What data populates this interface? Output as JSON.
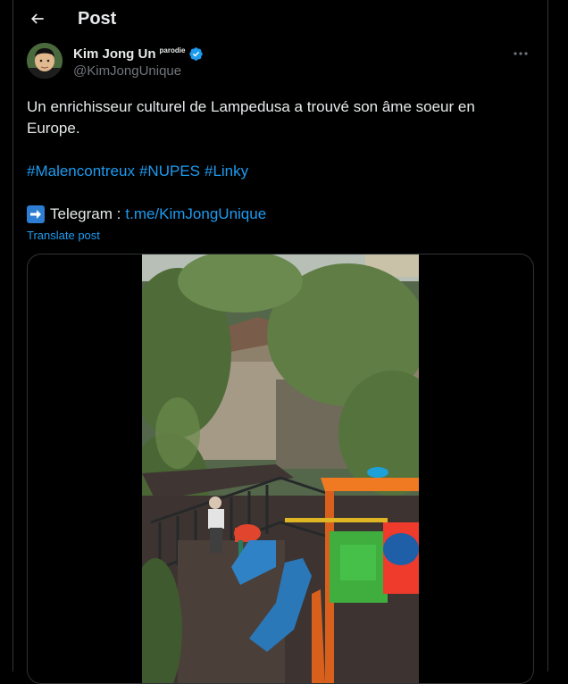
{
  "header": {
    "title": "Post"
  },
  "author": {
    "name": "Kim Jong Un",
    "parody_label": "parodie",
    "handle": "@KimJongUnique",
    "verified_color": "#1d9bf0"
  },
  "tweet": {
    "text": "Un enrichisseur culturel de Lampedusa a trouvé son âme soeur en Europe.",
    "hashtags": [
      "#Malencontreux",
      "#NUPES",
      "#Linky"
    ],
    "telegram_label": "Telegram :",
    "telegram_link": "t.me/KimJongUnique",
    "translate_label": "Translate post"
  },
  "colors": {
    "background": "#000000",
    "text": "#e7e9ea",
    "secondary": "#71767b",
    "link": "#1d9bf0",
    "border": "#2f3336"
  }
}
